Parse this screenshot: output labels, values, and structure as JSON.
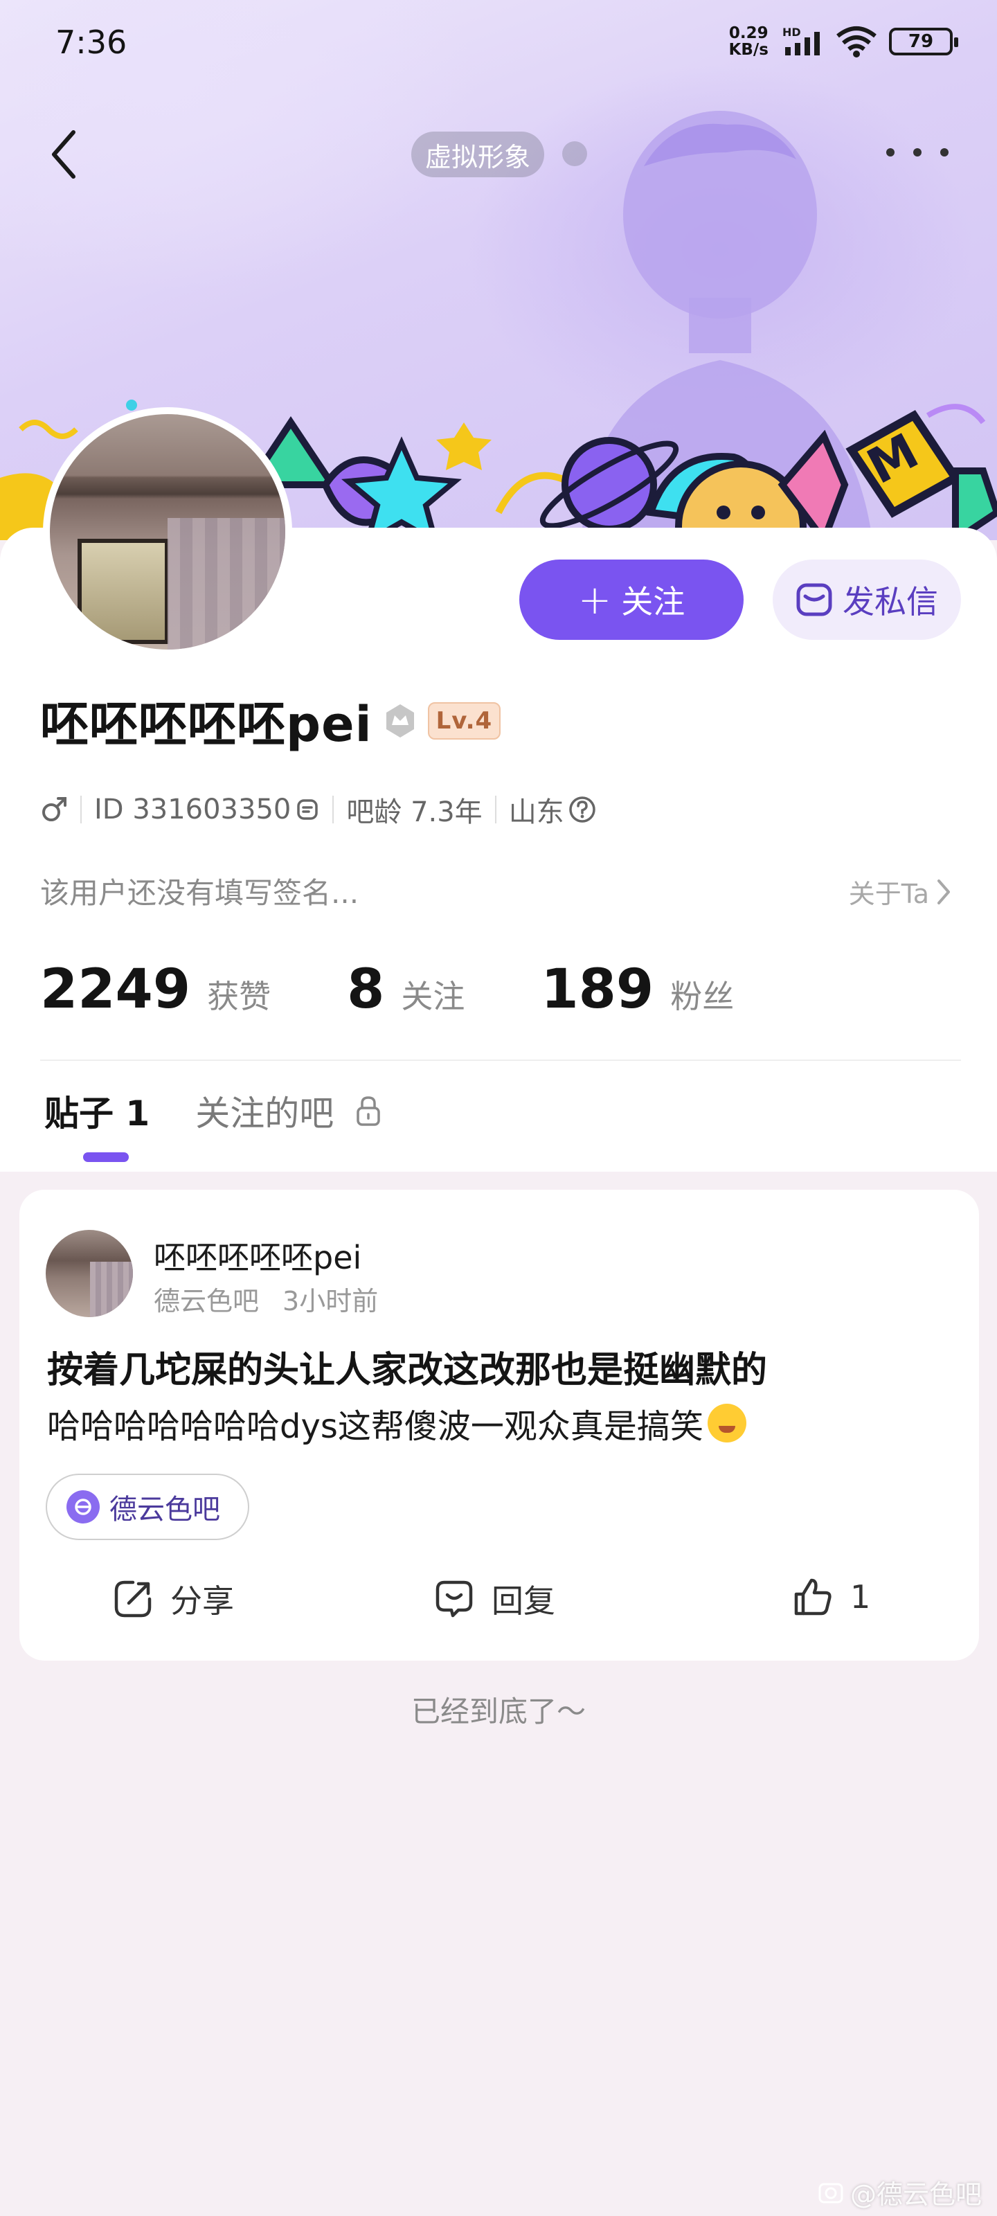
{
  "status_bar": {
    "time": "7:36",
    "net_speed_value": "0.29",
    "net_speed_unit": "KB/s",
    "network_type": "HD",
    "battery": "79"
  },
  "header": {
    "avatar_pill": "虚拟形象"
  },
  "profile": {
    "username": "呸呸呸呸呸pei",
    "level": "Lv.4",
    "user_id": "ID 331603350",
    "tieba_age": "吧龄 7.3年",
    "location": "山东",
    "signature": "该用户还没有填写签名...",
    "about_link": "关于Ta",
    "follow_label": "关注",
    "message_label": "发私信",
    "stats": [
      {
        "value": "2249",
        "label": "获赞"
      },
      {
        "value": "8",
        "label": "关注"
      },
      {
        "value": "189",
        "label": "粉丝"
      }
    ],
    "tabs": [
      {
        "label": "贴子 1",
        "active": true
      },
      {
        "label": "关注的吧",
        "active": false
      }
    ],
    "accent_color": "#7a54f0"
  },
  "post": {
    "author": "呸呸呸呸呸pei",
    "forum": "德云色吧",
    "time": "3小时前",
    "title": "按着几坨屎的头让人家改这改那也是挺幽默的",
    "body": "哈哈哈哈哈哈哈dys这帮傻波一观众真是搞笑",
    "tag": "德云色吧",
    "share_label": "分享",
    "reply_label": "回复",
    "like_count": "1"
  },
  "footer": {
    "end_text": "已经到底了～",
    "watermark": "@德云色吧"
  }
}
